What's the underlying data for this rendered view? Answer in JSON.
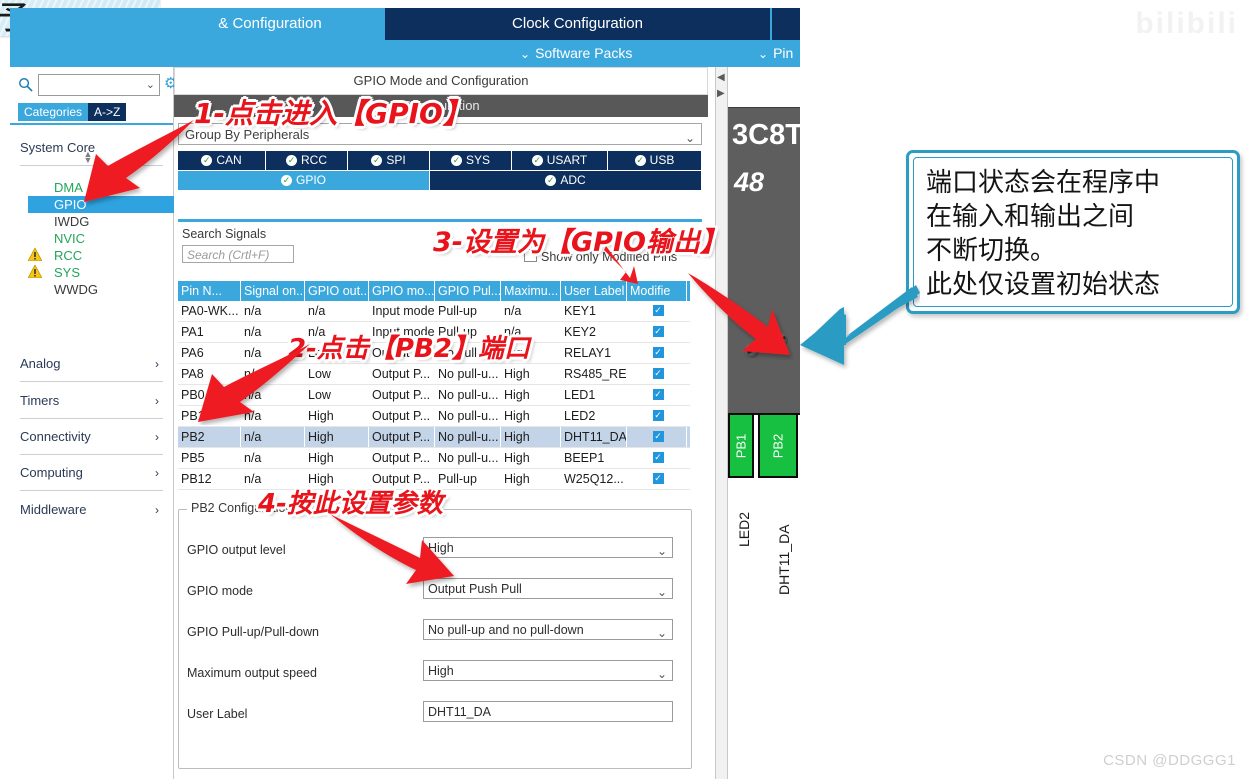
{
  "watermarks": {
    "top_right": "bilibili",
    "bottom_right": "CSDN @DDGGG1"
  },
  "top_left_fragment": {
    "text": "序"
  },
  "window": {
    "tabs": [
      {
        "label": "& Configuration",
        "state": "active"
      },
      {
        "label": "Clock Configuration",
        "state": "inactive"
      },
      {
        "label": "",
        "state": "inactive"
      }
    ],
    "toolbar": [
      {
        "label": "Software Packs",
        "caret": "⌄"
      },
      {
        "label": "Pin",
        "caret": "⌄"
      }
    ]
  },
  "sidebar": {
    "search": {
      "value": "",
      "placeholder": ""
    },
    "gear_icon": "⚙",
    "view_buttons": [
      {
        "label": "Categories",
        "active": true
      },
      {
        "label": "A->Z",
        "active": false
      }
    ],
    "sections": [
      {
        "label": "System Core",
        "expanded": true
      },
      {
        "label": "Analog",
        "expanded": false
      },
      {
        "label": "Timers",
        "expanded": false
      },
      {
        "label": "Connectivity",
        "expanded": false
      },
      {
        "label": "Computing",
        "expanded": false
      },
      {
        "label": "Middleware",
        "expanded": false
      }
    ],
    "peripherals": [
      {
        "label": "DMA",
        "style": "green",
        "selected": false,
        "warn": false
      },
      {
        "label": "GPIO",
        "style": "default",
        "selected": true,
        "warn": false
      },
      {
        "label": "IWDG",
        "style": "default",
        "selected": false,
        "warn": false
      },
      {
        "label": "NVIC",
        "style": "green",
        "selected": false,
        "warn": false
      },
      {
        "label": "RCC",
        "style": "green",
        "selected": false,
        "warn": true
      },
      {
        "label": "SYS",
        "style": "green",
        "selected": false,
        "warn": true
      },
      {
        "label": "WWDG",
        "style": "default",
        "selected": false,
        "warn": false
      }
    ]
  },
  "config_panel": {
    "mode_header": "GPIO Mode and Configuration",
    "gray_bar": "Configuration",
    "group_by": "Group By Peripherals",
    "peripheral_tabs_row1": [
      {
        "label": "CAN",
        "active": false
      },
      {
        "label": "RCC",
        "active": false
      },
      {
        "label": "SPI",
        "active": false
      },
      {
        "label": "SYS",
        "active": false
      },
      {
        "label": "USART",
        "active": false
      },
      {
        "label": "USB",
        "active": false
      }
    ],
    "peripheral_tabs_row2": [
      {
        "label": "GPIO",
        "active": true
      },
      {
        "label": "ADC",
        "active": false
      }
    ],
    "search_signals_label": "Search Signals",
    "search_signals_placeholder": "Search (Crtl+F)",
    "show_only_modified_pins": "Show only Modified Pins",
    "table": {
      "columns": [
        "Pin N...",
        "Signal on...",
        "GPIO out...",
        "GPIO mo...",
        "GPIO Pul...",
        "Maximu...",
        "User Label",
        "Modifie"
      ],
      "rows": [
        {
          "cells": [
            "PA0-WK...",
            "n/a",
            "n/a",
            "Input mode",
            "Pull-up",
            "n/a",
            "KEY1"
          ],
          "modified": true,
          "selected": false
        },
        {
          "cells": [
            "PA1",
            "n/a",
            "n/a",
            "Input mode",
            "Pull-up",
            "n/a",
            "KEY2"
          ],
          "modified": true,
          "selected": false
        },
        {
          "cells": [
            "PA6",
            "n/a",
            "Low",
            "Output P...",
            "No pull-u...",
            "High",
            "RELAY1"
          ],
          "modified": true,
          "selected": false
        },
        {
          "cells": [
            "PA8",
            "n/a",
            "Low",
            "Output P...",
            "No pull-u...",
            "High",
            "RS485_RE"
          ],
          "modified": true,
          "selected": false
        },
        {
          "cells": [
            "PB0",
            "n/a",
            "Low",
            "Output P...",
            "No pull-u...",
            "High",
            "LED1"
          ],
          "modified": true,
          "selected": false
        },
        {
          "cells": [
            "PB1",
            "n/a",
            "High",
            "Output P...",
            "No pull-u...",
            "High",
            "LED2"
          ],
          "modified": true,
          "selected": false
        },
        {
          "cells": [
            "PB2",
            "n/a",
            "High",
            "Output P...",
            "No pull-u...",
            "High",
            "DHT11_DA"
          ],
          "modified": true,
          "selected": true
        },
        {
          "cells": [
            "PB5",
            "n/a",
            "High",
            "Output P...",
            "No pull-u...",
            "High",
            "BEEP1"
          ],
          "modified": true,
          "selected": false
        },
        {
          "cells": [
            "PB12",
            "n/a",
            "High",
            "Output P...",
            "Pull-up",
            "High",
            "W25Q12..."
          ],
          "modified": true,
          "selected": false
        }
      ]
    },
    "pin_config": {
      "legend": "PB2 Configuration :",
      "fields": [
        {
          "label": "GPIO output level",
          "value": "High",
          "type": "select"
        },
        {
          "label": "GPIO mode",
          "value": "Output Push Pull",
          "type": "select"
        },
        {
          "label": "GPIO Pull-up/Pull-down",
          "value": "No pull-up and no pull-down",
          "type": "select"
        },
        {
          "label": "Maximum output speed",
          "value": "High",
          "type": "select"
        },
        {
          "label": "User Label",
          "value": "DHT11_DA",
          "type": "text"
        }
      ]
    }
  },
  "chip": {
    "part_marking": "3C8T",
    "part_marking2": "48",
    "pads": [
      {
        "name": "PB1",
        "label": "LED2"
      },
      {
        "name": "PB2",
        "label": "DHT11_DA"
      }
    ]
  },
  "annotations": {
    "step1": "1-点击进入【GPIO】",
    "step2": "2-点击【PB2】端口",
    "step3": "3-设置为【GPIO输出】",
    "step4": "4-按此设置参数",
    "callout": [
      "端口状态会在程序中",
      "在输入和输出之间",
      "不断切换。",
      "此处仅设置初始状态"
    ]
  },
  "colors": {
    "accent_blue": "#3ba8dd",
    "navy": "#0d2f5e",
    "annotation_red": "#e8131b",
    "callout_border": "#2b9cc4",
    "pad_green": "#18c042",
    "selected_row": "#c3d4e8"
  }
}
